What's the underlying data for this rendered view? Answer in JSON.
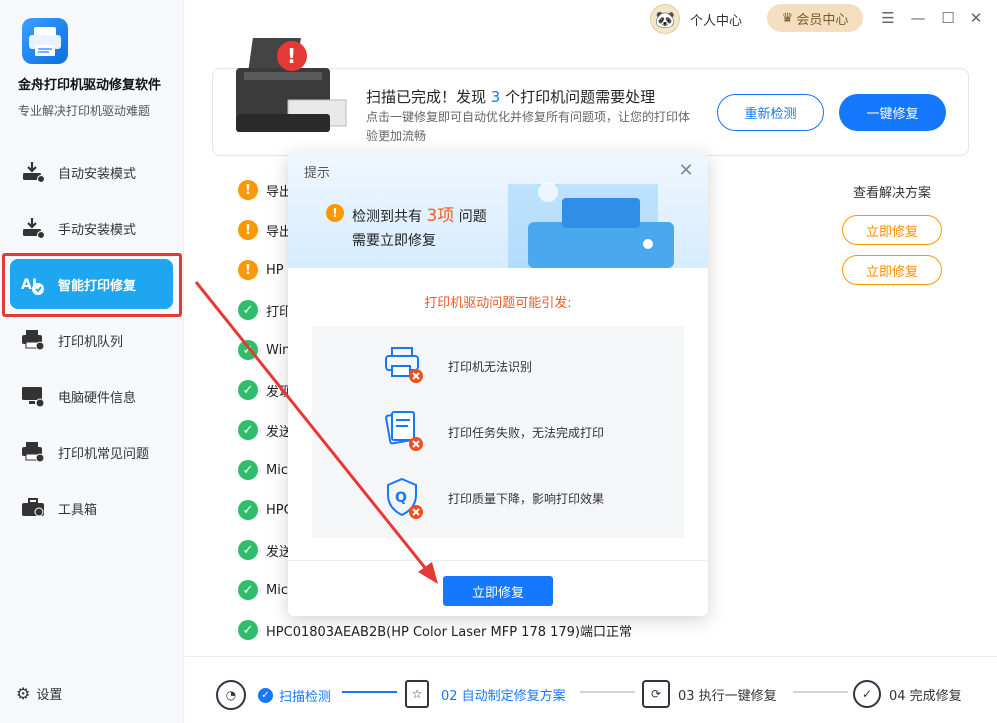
{
  "app": {
    "title": "金舟打印机驱动修复软件",
    "subtitle": "专业解决打印机驱动难题"
  },
  "sidebar": {
    "items": [
      {
        "label": "自动安装模式",
        "icon": "driver-install-icon"
      },
      {
        "label": "手动安装模式",
        "icon": "manual-install-icon"
      },
      {
        "label": "智能打印修复",
        "icon": "smart-repair-icon"
      },
      {
        "label": "打印机队列",
        "icon": "print-queue-icon"
      },
      {
        "label": "电脑硬件信息",
        "icon": "hardware-info-icon"
      },
      {
        "label": "打印机常见问题",
        "icon": "faq-icon"
      },
      {
        "label": "工具箱",
        "icon": "toolbox-icon"
      }
    ],
    "active_index": 2,
    "settings_label": "设置"
  },
  "topbar": {
    "user_label": "个人中心",
    "vip_label": "会员中心"
  },
  "scan": {
    "title_prefix": "扫描已完成！发现 ",
    "count": "3",
    "title_suffix": " 个打印机问题需要处理",
    "description": "点击一键修复即可自动优化并修复所有问题项，让您的打印体验更加流畅",
    "recheck_label": "重新检测",
    "fix_all_label": "一键修复"
  },
  "results": {
    "action_header": "查看解决方案",
    "fix_label": "立即修复",
    "rows": [
      {
        "status": "warn",
        "text": "导出"
      },
      {
        "status": "warn",
        "text": "导出"
      },
      {
        "status": "warn",
        "text": "HP"
      },
      {
        "status": "ok",
        "text": "打印"
      },
      {
        "status": "ok",
        "text": "Win"
      },
      {
        "status": "ok",
        "text": "发现"
      },
      {
        "status": "ok",
        "text": "发送"
      },
      {
        "status": "ok",
        "text": "Mic"
      },
      {
        "status": "ok",
        "text": "HPC"
      },
      {
        "status": "ok",
        "text": "发送"
      },
      {
        "status": "ok",
        "text": "Mic"
      },
      {
        "status": "ok",
        "text": "HPC01803AEAB2B(HP Color Laser MFP 178 179)端口正常"
      }
    ]
  },
  "steps": [
    {
      "label": "扫描检测",
      "state": "done"
    },
    {
      "label": "02 自动制定修复方案",
      "state": "active"
    },
    {
      "label": "03 执行一键修复",
      "state": "pending"
    },
    {
      "label": "04 完成修复",
      "state": "pending"
    }
  ],
  "modal": {
    "title": "提示",
    "message_prefix": "检测到共有 ",
    "message_count": "3项",
    "message_suffix": " 问题",
    "message_line2": "需要立即修复",
    "cause_heading": "打印机驱动问题可能引发:",
    "issues": [
      {
        "label": "打印机无法识别",
        "icon": "printer-error-icon"
      },
      {
        "label": "打印任务失败，无法完成打印",
        "icon": "document-error-icon"
      },
      {
        "label": "打印质量下降，影响打印效果",
        "icon": "quality-error-icon"
      }
    ],
    "button_label": "立即修复"
  },
  "colors": {
    "accent": "#1677ff",
    "sidebar_active": "#1ea7f0",
    "warning": "#ff9800",
    "success": "#2ebd6b",
    "annotation_red": "#e53935"
  }
}
